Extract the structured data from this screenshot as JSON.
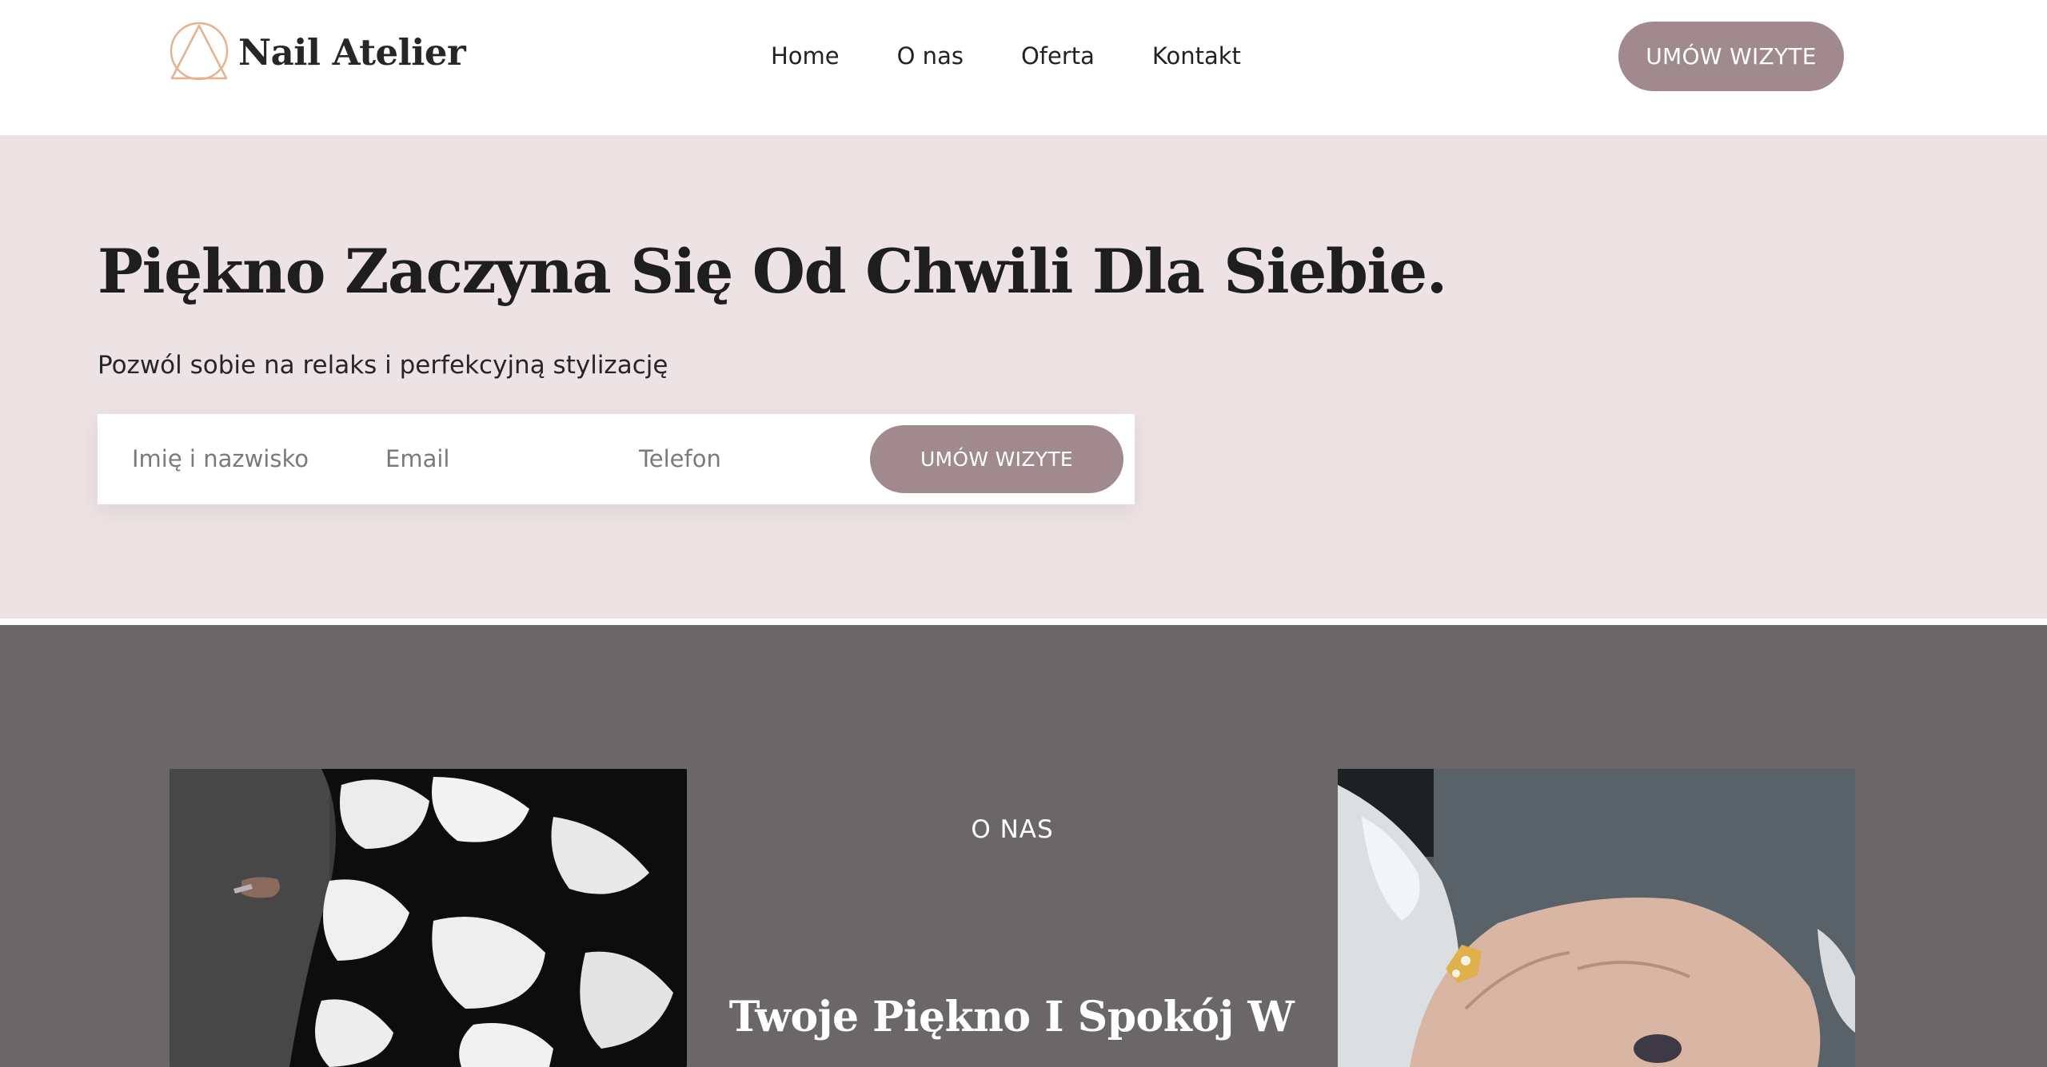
{
  "brand": {
    "name": "Nail Atelier",
    "logo_icon": "triangle-in-circle-icon",
    "logo_color": "#e6b18f"
  },
  "nav": {
    "items": [
      {
        "label": "Home"
      },
      {
        "label": "O nas"
      },
      {
        "label": "Oferta"
      },
      {
        "label": "Kontakt"
      }
    ]
  },
  "header": {
    "cta_label": "UMÓW WIZYTE"
  },
  "hero": {
    "title": "Piękno Zaczyna Się Od Chwili Dla Siebie.",
    "subtitle": "Pozwól sobie na relaks i perfekcyjną stylizację",
    "form": {
      "name_placeholder": "Imię i nazwisko",
      "email_placeholder": "Email",
      "phone_placeholder": "Telefon",
      "submit_label": "UMÓW WIZYTE"
    }
  },
  "about": {
    "eyebrow": "O NAS",
    "title": "Twoje Piękno I Spokój W"
  },
  "colors": {
    "accent": "#a08a8e",
    "hero_bg": "#ede3e5",
    "about_bg": "#6b6769",
    "text_dark": "#1e1e1e"
  }
}
